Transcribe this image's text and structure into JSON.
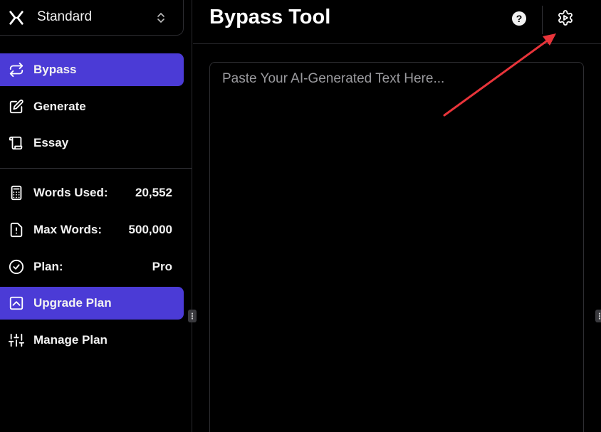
{
  "sidebar": {
    "mode": {
      "label": "Standard",
      "logo_icon": "x-logo-icon",
      "chevron_icon": "chevron-up-down-icon"
    },
    "nav": [
      {
        "label": "Bypass",
        "icon": "arrows-swap-icon",
        "active": true
      },
      {
        "label": "Generate",
        "icon": "pencil-square-icon",
        "active": false
      },
      {
        "label": "Essay",
        "icon": "scroll-icon",
        "active": false
      }
    ],
    "stats": [
      {
        "label": "Words Used:",
        "value": "20,552",
        "icon": "calculator-icon"
      },
      {
        "label": "Max Words:",
        "value": "500,000",
        "icon": "file-alert-icon"
      },
      {
        "label": "Plan:",
        "value": "Pro",
        "icon": "check-circle-icon"
      }
    ],
    "actions": [
      {
        "label": "Upgrade Plan",
        "icon": "upgrade-arrow-icon",
        "active": true
      },
      {
        "label": "Manage Plan",
        "icon": "sliders-icon",
        "active": false
      }
    ]
  },
  "header": {
    "title": "Bypass Tool",
    "help_label": "?",
    "settings_icon": "gear-icon"
  },
  "editor": {
    "placeholder": "Paste Your AI-Generated Text Here...",
    "value": ""
  },
  "colors": {
    "accent": "#4b3bd6",
    "background": "#000000",
    "annotation_arrow": "#e8343a"
  }
}
